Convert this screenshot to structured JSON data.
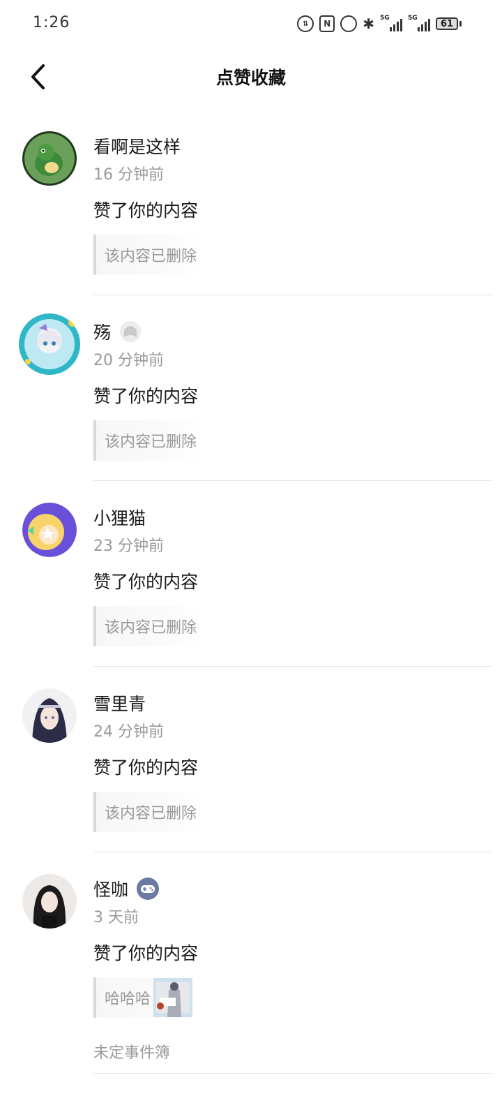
{
  "status_bar": {
    "time": "1:26",
    "signal1_label": "5G",
    "signal2_label": "5G",
    "battery": "61"
  },
  "header": {
    "title": "点赞收藏"
  },
  "items": [
    {
      "name": "看啊是这样",
      "time": "16 分钟前",
      "action": "赞了你的内容",
      "quote": "该内容已删除"
    },
    {
      "name": "殇",
      "time": "20 分钟前",
      "action": "赞了你的内容",
      "quote": "该内容已删除"
    },
    {
      "name": "小狸猫",
      "time": "23 分钟前",
      "action": "赞了你的内容",
      "quote": "该内容已删除"
    },
    {
      "name": "雪里青",
      "time": "24 分钟前",
      "action": "赞了你的内容",
      "quote": "该内容已删除"
    },
    {
      "name": "怪咖",
      "time": "3 天前",
      "action": "赞了你的内容",
      "quote": "哈哈哈",
      "source": "未定事件簿"
    }
  ],
  "colors": {
    "text_primary": "#1a1a1a",
    "text_secondary": "#999999",
    "divider": "#e5e5e5",
    "quote_bar": "#d9d9d9"
  }
}
